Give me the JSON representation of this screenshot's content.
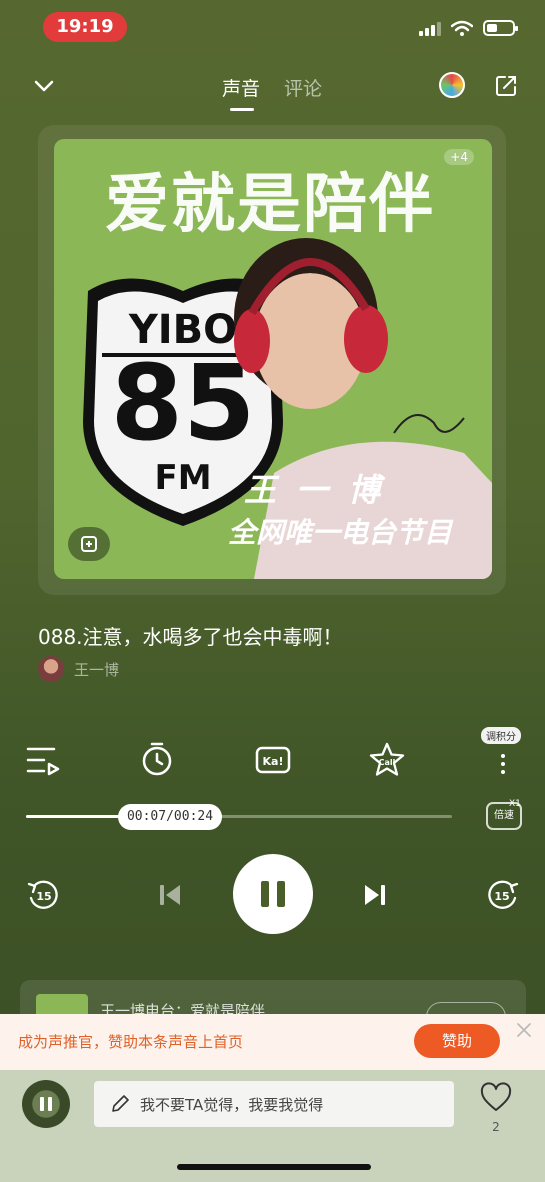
{
  "status_bar": {
    "time": "19:19"
  },
  "header": {
    "tabs": [
      {
        "label": "声音",
        "active": true
      },
      {
        "label": "评论",
        "active": false
      }
    ]
  },
  "cover": {
    "title": "爱就是陪伴",
    "shield_top": "YIBO",
    "shield_number": "85",
    "shield_bottom": "FM",
    "name": "王一博",
    "subtitle": "全网唯一电台节目",
    "count": "+4"
  },
  "track": {
    "title": "088.注意，水喝多了也会中毒啊！",
    "author": "王一博"
  },
  "controls": {
    "rate_badge": "调积分",
    "ka_label": "Ka!",
    "call_label": "Call"
  },
  "progress": {
    "current": "00:07",
    "total": "00:24",
    "time_display": "00:07/00:24",
    "fraction": 0.22
  },
  "speed": {
    "label": "倍速",
    "value": "X1"
  },
  "playback": {
    "rewind_seconds": "15",
    "forward_seconds": "15"
  },
  "album": {
    "title": "王一博电台：爱就是陪伴"
  },
  "promo": {
    "text": "成为声推官，赞助本条声音上首页",
    "button": "赞助"
  },
  "bottom": {
    "comment_placeholder": "我不要TA觉得，我要我觉得",
    "like_count": "2"
  },
  "colors": {
    "background": "#50652e",
    "cover_green": "#8bb757",
    "promo_orange": "#ee5a24",
    "time_pill_red": "#e23b3b"
  }
}
